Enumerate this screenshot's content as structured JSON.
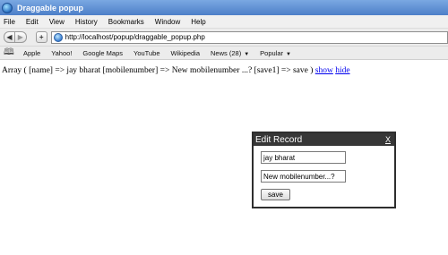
{
  "window": {
    "title": "Draggable popup"
  },
  "menu": [
    "File",
    "Edit",
    "View",
    "History",
    "Bookmarks",
    "Window",
    "Help"
  ],
  "nav": {
    "back": "◀",
    "forward": "▶",
    "add": "+",
    "url": "http://localhost/popup/draggable_popup.php"
  },
  "bookmarks": {
    "items": [
      "Apple",
      "Yahoo!",
      "Google Maps",
      "YouTube",
      "Wikipedia",
      "News (28)",
      "Popular"
    ]
  },
  "content": {
    "array_text": "Array ( [name] => jay bharat [mobilenumber] => New mobilenumber ...? [save1] => save )",
    "show_link": "show",
    "hide_link": "hide"
  },
  "popup": {
    "title": "Edit Record",
    "close": "X",
    "name_value": "jay bharat",
    "mobile_value": "New mobilenumber...?",
    "save_label": "save"
  }
}
